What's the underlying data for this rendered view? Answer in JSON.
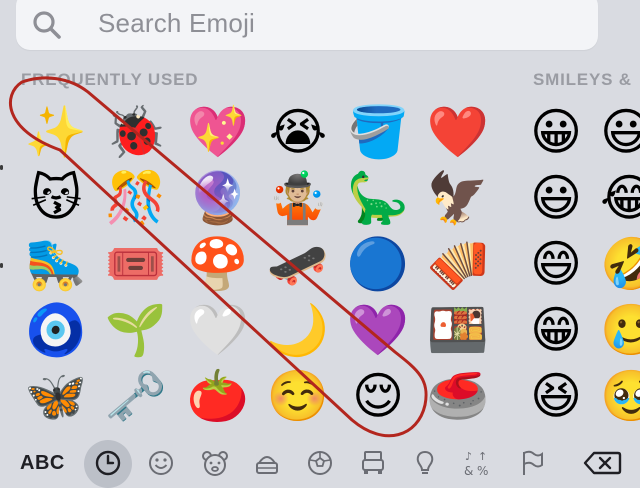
{
  "search": {
    "placeholder": "Search Emoji"
  },
  "sections": {
    "frequently_used": "FREQUENTLY USED",
    "smileys": "SMILEYS &"
  },
  "frequently_used_grid": [
    [
      "✨",
      "🐞",
      "💖",
      "😭",
      "🪣",
      "❤️"
    ],
    [
      "😽",
      "🎊",
      "🔮",
      "🤹🏼",
      "🦕",
      "🦅"
    ],
    [
      "🛼",
      "🎟️",
      "🍄",
      "🛹",
      "🔵",
      "🪗"
    ],
    [
      "🧿",
      "🌱",
      "🤍",
      "🌙",
      "💜",
      "🍱"
    ],
    [
      "🦋",
      "🗝️",
      "🍅",
      "☺️",
      "😌",
      "🥌"
    ]
  ],
  "smileys_grid": [
    [
      "😀",
      "😃"
    ],
    [
      "😃",
      "😂"
    ],
    [
      "😄",
      "🤣"
    ],
    [
      "😁",
      "🥲"
    ],
    [
      "😆",
      "🥹"
    ]
  ],
  "bottom_bar": {
    "abc_label": "ABC",
    "categories": [
      "recents",
      "smileys",
      "animals",
      "food",
      "activity",
      "travel",
      "objects",
      "symbols",
      "flags"
    ],
    "selected": "recents"
  },
  "colors": {
    "background": "#d9dbe1",
    "search_bg": "#f3f4f7",
    "annotation": "#b3261e",
    "label_gray": "#9a9ca3"
  }
}
